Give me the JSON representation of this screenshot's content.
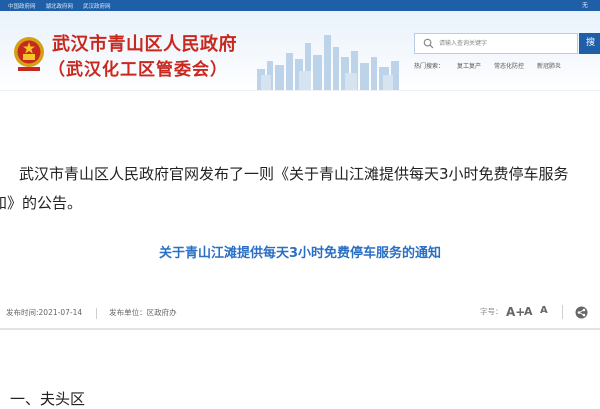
{
  "top_links": [
    "中国政府网",
    "湖北政府网",
    "武汉政府网"
  ],
  "lang": "无",
  "header": {
    "title_line1": "武汉市青山区人民政府",
    "title_line2": "（武汉化工区管委会）"
  },
  "search": {
    "placeholder": "请输入查询关键字",
    "button": "搜"
  },
  "hot_search": [
    "热门搜索：",
    "复工复产",
    "常态化防控",
    "新冠肺炎"
  ],
  "intro": {
    "line1": "武汉市青山区人民政府官网发布了一则《关于青山江滩提供每天3小时免费停车服务",
    "line2": "知》的公告。"
  },
  "article": {
    "title": "关于青山江滩提供每天3小时免费停车服务的通知",
    "publish_date": "发布时间:2021-07-14",
    "publisher": "发布单位：区政府办",
    "font_size_label": "字号：",
    "font_buttons": [
      "A+",
      "A",
      "A"
    ]
  },
  "cutoff_text": "一、夫头区",
  "colors": {
    "brand_blue": "#1f5fa8",
    "title_red": "#c8281e",
    "article_title_blue": "#2a6fc4"
  },
  "icons": [
    "national-emblem-icon",
    "search-icon",
    "share-icon"
  ]
}
